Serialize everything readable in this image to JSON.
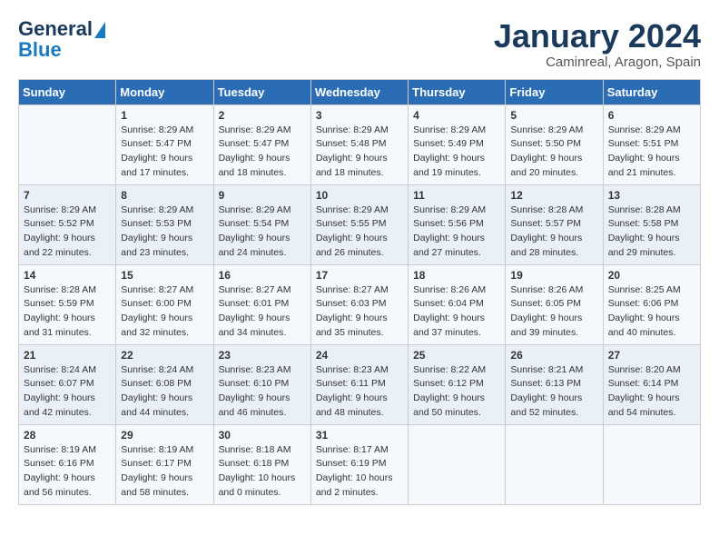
{
  "header": {
    "logo_line1": "General",
    "logo_line2": "Blue",
    "month_year": "January 2024",
    "location": "Caminreal, Aragon, Spain"
  },
  "days_of_week": [
    "Sunday",
    "Monday",
    "Tuesday",
    "Wednesday",
    "Thursday",
    "Friday",
    "Saturday"
  ],
  "weeks": [
    [
      {
        "day": "",
        "sunrise": "",
        "sunset": "",
        "daylight": ""
      },
      {
        "day": "1",
        "sunrise": "Sunrise: 8:29 AM",
        "sunset": "Sunset: 5:47 PM",
        "daylight": "Daylight: 9 hours and 17 minutes."
      },
      {
        "day": "2",
        "sunrise": "Sunrise: 8:29 AM",
        "sunset": "Sunset: 5:47 PM",
        "daylight": "Daylight: 9 hours and 18 minutes."
      },
      {
        "day": "3",
        "sunrise": "Sunrise: 8:29 AM",
        "sunset": "Sunset: 5:48 PM",
        "daylight": "Daylight: 9 hours and 18 minutes."
      },
      {
        "day": "4",
        "sunrise": "Sunrise: 8:29 AM",
        "sunset": "Sunset: 5:49 PM",
        "daylight": "Daylight: 9 hours and 19 minutes."
      },
      {
        "day": "5",
        "sunrise": "Sunrise: 8:29 AM",
        "sunset": "Sunset: 5:50 PM",
        "daylight": "Daylight: 9 hours and 20 minutes."
      },
      {
        "day": "6",
        "sunrise": "Sunrise: 8:29 AM",
        "sunset": "Sunset: 5:51 PM",
        "daylight": "Daylight: 9 hours and 21 minutes."
      }
    ],
    [
      {
        "day": "7",
        "sunrise": "Sunrise: 8:29 AM",
        "sunset": "Sunset: 5:52 PM",
        "daylight": "Daylight: 9 hours and 22 minutes."
      },
      {
        "day": "8",
        "sunrise": "Sunrise: 8:29 AM",
        "sunset": "Sunset: 5:53 PM",
        "daylight": "Daylight: 9 hours and 23 minutes."
      },
      {
        "day": "9",
        "sunrise": "Sunrise: 8:29 AM",
        "sunset": "Sunset: 5:54 PM",
        "daylight": "Daylight: 9 hours and 24 minutes."
      },
      {
        "day": "10",
        "sunrise": "Sunrise: 8:29 AM",
        "sunset": "Sunset: 5:55 PM",
        "daylight": "Daylight: 9 hours and 26 minutes."
      },
      {
        "day": "11",
        "sunrise": "Sunrise: 8:29 AM",
        "sunset": "Sunset: 5:56 PM",
        "daylight": "Daylight: 9 hours and 27 minutes."
      },
      {
        "day": "12",
        "sunrise": "Sunrise: 8:28 AM",
        "sunset": "Sunset: 5:57 PM",
        "daylight": "Daylight: 9 hours and 28 minutes."
      },
      {
        "day": "13",
        "sunrise": "Sunrise: 8:28 AM",
        "sunset": "Sunset: 5:58 PM",
        "daylight": "Daylight: 9 hours and 29 minutes."
      }
    ],
    [
      {
        "day": "14",
        "sunrise": "Sunrise: 8:28 AM",
        "sunset": "Sunset: 5:59 PM",
        "daylight": "Daylight: 9 hours and 31 minutes."
      },
      {
        "day": "15",
        "sunrise": "Sunrise: 8:27 AM",
        "sunset": "Sunset: 6:00 PM",
        "daylight": "Daylight: 9 hours and 32 minutes."
      },
      {
        "day": "16",
        "sunrise": "Sunrise: 8:27 AM",
        "sunset": "Sunset: 6:01 PM",
        "daylight": "Daylight: 9 hours and 34 minutes."
      },
      {
        "day": "17",
        "sunrise": "Sunrise: 8:27 AM",
        "sunset": "Sunset: 6:03 PM",
        "daylight": "Daylight: 9 hours and 35 minutes."
      },
      {
        "day": "18",
        "sunrise": "Sunrise: 8:26 AM",
        "sunset": "Sunset: 6:04 PM",
        "daylight": "Daylight: 9 hours and 37 minutes."
      },
      {
        "day": "19",
        "sunrise": "Sunrise: 8:26 AM",
        "sunset": "Sunset: 6:05 PM",
        "daylight": "Daylight: 9 hours and 39 minutes."
      },
      {
        "day": "20",
        "sunrise": "Sunrise: 8:25 AM",
        "sunset": "Sunset: 6:06 PM",
        "daylight": "Daylight: 9 hours and 40 minutes."
      }
    ],
    [
      {
        "day": "21",
        "sunrise": "Sunrise: 8:24 AM",
        "sunset": "Sunset: 6:07 PM",
        "daylight": "Daylight: 9 hours and 42 minutes."
      },
      {
        "day": "22",
        "sunrise": "Sunrise: 8:24 AM",
        "sunset": "Sunset: 6:08 PM",
        "daylight": "Daylight: 9 hours and 44 minutes."
      },
      {
        "day": "23",
        "sunrise": "Sunrise: 8:23 AM",
        "sunset": "Sunset: 6:10 PM",
        "daylight": "Daylight: 9 hours and 46 minutes."
      },
      {
        "day": "24",
        "sunrise": "Sunrise: 8:23 AM",
        "sunset": "Sunset: 6:11 PM",
        "daylight": "Daylight: 9 hours and 48 minutes."
      },
      {
        "day": "25",
        "sunrise": "Sunrise: 8:22 AM",
        "sunset": "Sunset: 6:12 PM",
        "daylight": "Daylight: 9 hours and 50 minutes."
      },
      {
        "day": "26",
        "sunrise": "Sunrise: 8:21 AM",
        "sunset": "Sunset: 6:13 PM",
        "daylight": "Daylight: 9 hours and 52 minutes."
      },
      {
        "day": "27",
        "sunrise": "Sunrise: 8:20 AM",
        "sunset": "Sunset: 6:14 PM",
        "daylight": "Daylight: 9 hours and 54 minutes."
      }
    ],
    [
      {
        "day": "28",
        "sunrise": "Sunrise: 8:19 AM",
        "sunset": "Sunset: 6:16 PM",
        "daylight": "Daylight: 9 hours and 56 minutes."
      },
      {
        "day": "29",
        "sunrise": "Sunrise: 8:19 AM",
        "sunset": "Sunset: 6:17 PM",
        "daylight": "Daylight: 9 hours and 58 minutes."
      },
      {
        "day": "30",
        "sunrise": "Sunrise: 8:18 AM",
        "sunset": "Sunset: 6:18 PM",
        "daylight": "Daylight: 10 hours and 0 minutes."
      },
      {
        "day": "31",
        "sunrise": "Sunrise: 8:17 AM",
        "sunset": "Sunset: 6:19 PM",
        "daylight": "Daylight: 10 hours and 2 minutes."
      },
      {
        "day": "",
        "sunrise": "",
        "sunset": "",
        "daylight": ""
      },
      {
        "day": "",
        "sunrise": "",
        "sunset": "",
        "daylight": ""
      },
      {
        "day": "",
        "sunrise": "",
        "sunset": "",
        "daylight": ""
      }
    ]
  ]
}
